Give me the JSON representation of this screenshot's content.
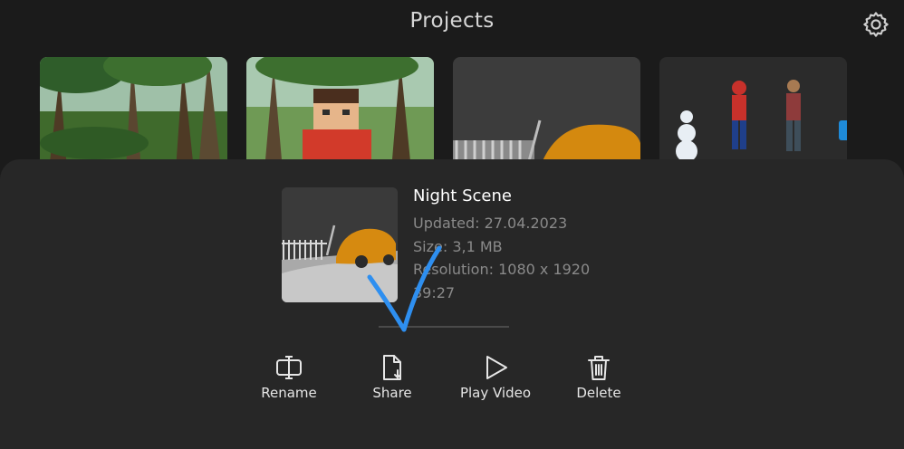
{
  "header": {
    "title": "Projects"
  },
  "project": {
    "name": "Night Scene",
    "updated": "Updated: 27.04.2023",
    "size": "Size: 3,1 MB",
    "resolution": "Resolution: 1080 x 1920",
    "duration": "39:27"
  },
  "actions": [
    {
      "label": "Rename",
      "icon": "rename-icon"
    },
    {
      "label": "Share",
      "icon": "share-file-icon"
    },
    {
      "label": "Play Video",
      "icon": "play-icon"
    },
    {
      "label": "Delete",
      "icon": "trash-icon"
    }
  ],
  "colors": {
    "background": "#1b1b1b",
    "sheet": "#272727",
    "annotation_arrow": "#2e8ff0"
  }
}
